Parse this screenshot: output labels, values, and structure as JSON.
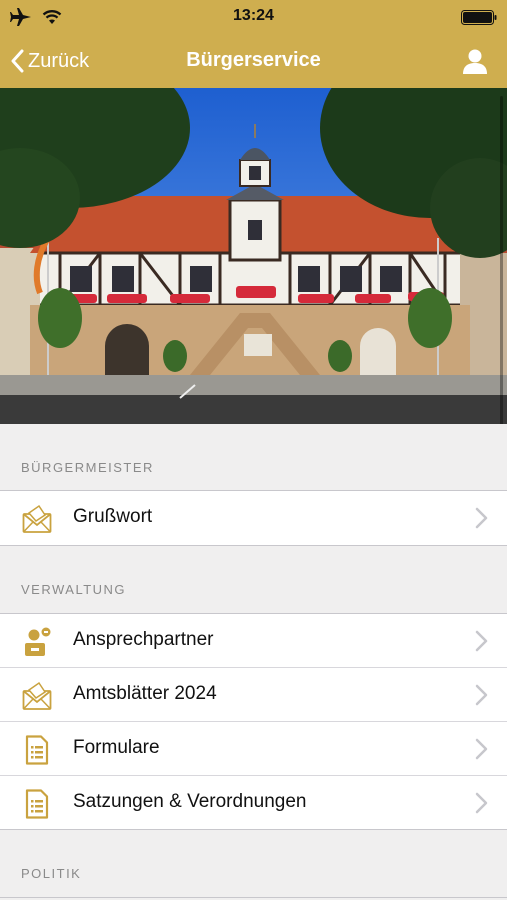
{
  "status_bar": {
    "time": "13:24",
    "icons": [
      "airplane-icon",
      "wifi-icon",
      "battery-icon"
    ]
  },
  "nav": {
    "back_label": "Zurück",
    "title": "Bürgerservice",
    "right_icon": "person-icon"
  },
  "colors": {
    "brand": "#cfae4f",
    "icon_accent": "#c9a23f",
    "section_text": "#8a8a8a",
    "background": "#f0efef"
  },
  "sections": [
    {
      "title": "BÜRGERMEISTER",
      "items": [
        {
          "label": "Grußwort",
          "icon": "envelope-letter-icon"
        }
      ]
    },
    {
      "title": "VERWALTUNG",
      "items": [
        {
          "label": "Ansprechpartner",
          "icon": "contact-person-icon"
        },
        {
          "label": "Amtsblätter 2024",
          "icon": "envelope-letter-icon"
        },
        {
          "label": "Formulare",
          "icon": "document-icon"
        },
        {
          "label": "Satzungen & Verordnungen",
          "icon": "document-icon"
        }
      ]
    },
    {
      "title": "POLITIK",
      "items": []
    }
  ]
}
